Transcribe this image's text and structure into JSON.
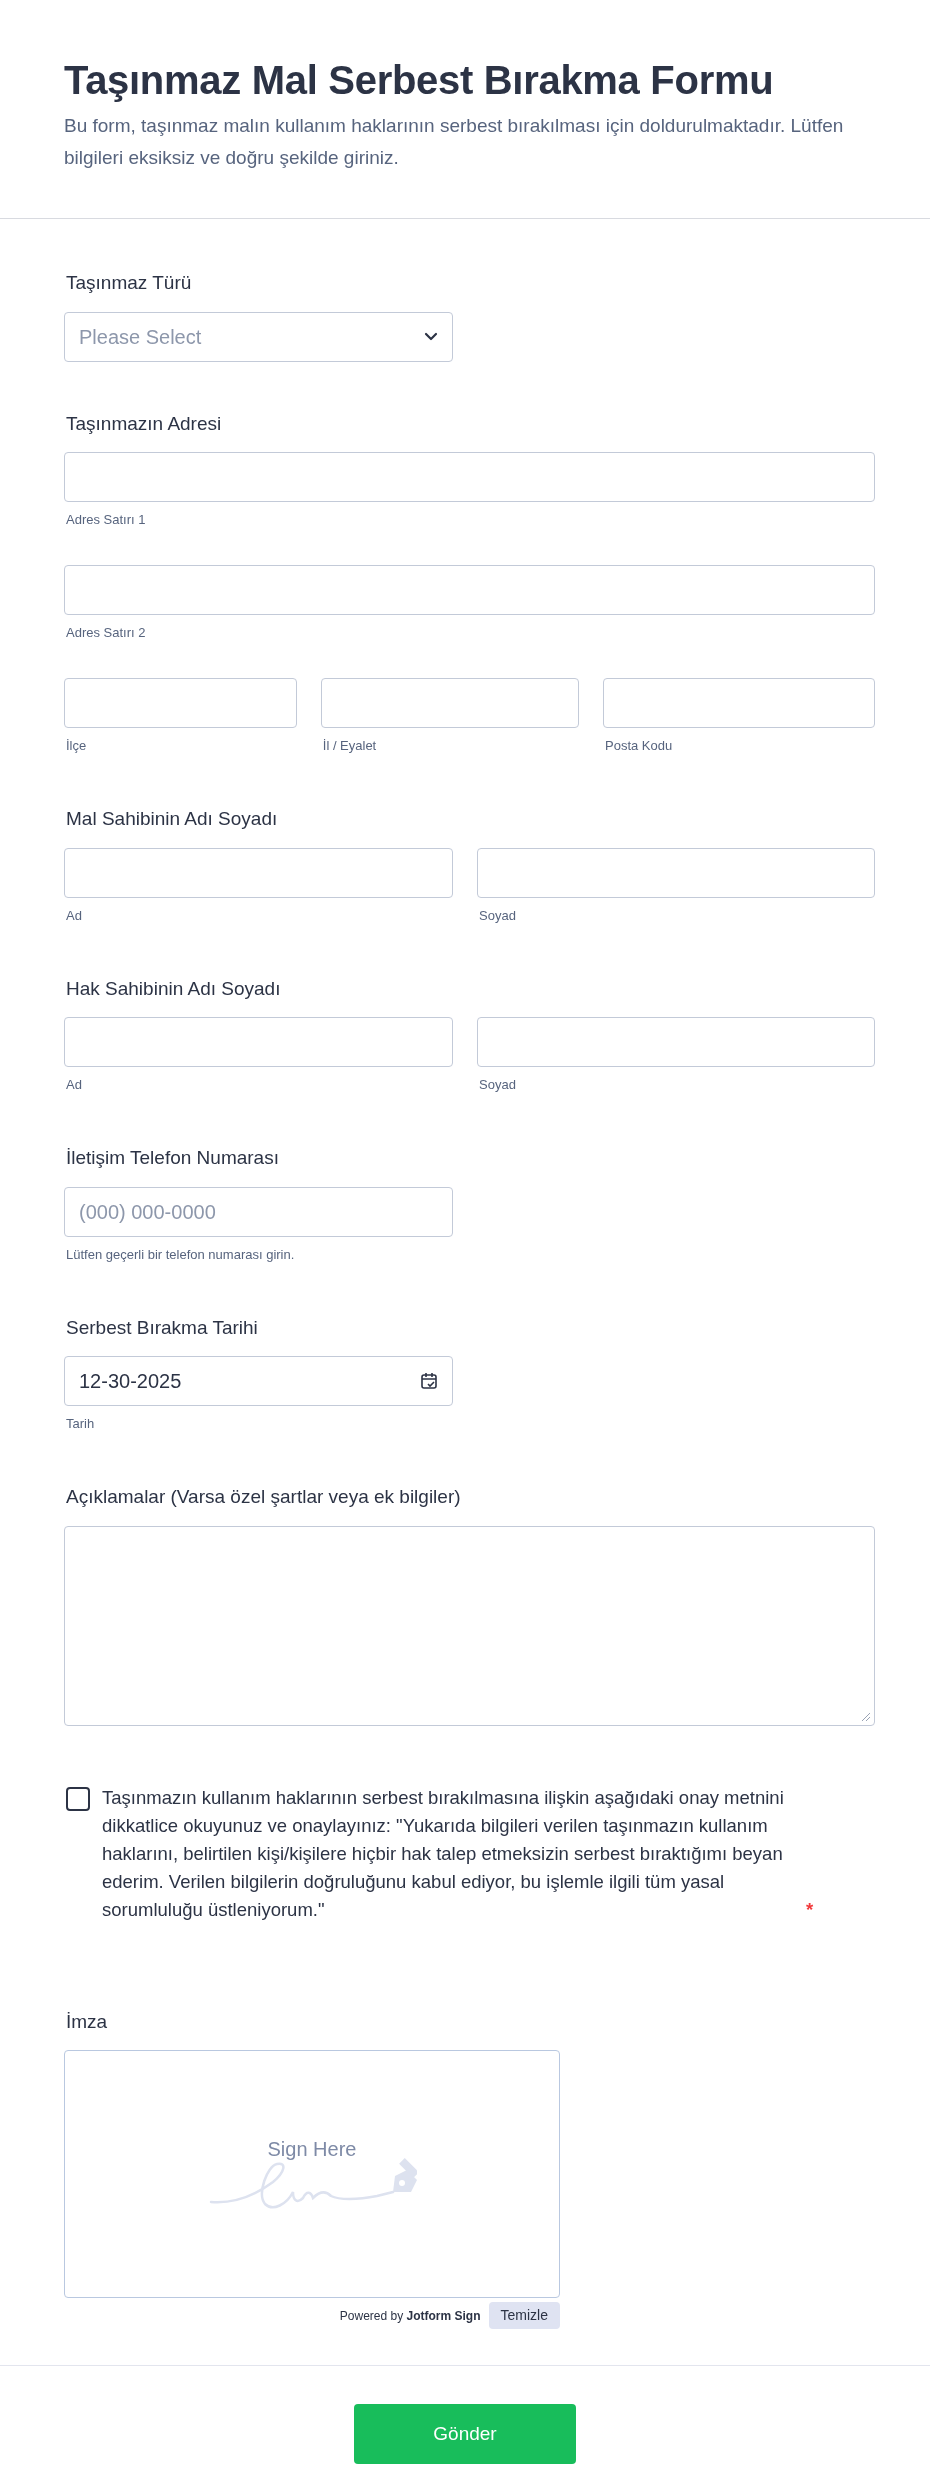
{
  "header": {
    "title": "Taşınmaz Mal Serbest Bırakma Formu",
    "description": "Bu form, taşınmaz malın kullanım haklarının serbest bırakılması için doldurulmaktadır. Lütfen bilgileri eksiksiz ve doğru şekilde giriniz."
  },
  "fields": [
    {
      "kind": "select",
      "label": "Taşınmaz Türü",
      "placeholder": "Please Select"
    },
    {
      "kind": "address",
      "label": "Taşınmazın Adresi",
      "rows": [
        [
          {
            "sublabel": "Adres Satırı 1"
          }
        ],
        [
          {
            "sublabel": "Adres Satırı 2"
          }
        ],
        [
          {
            "sublabel": "İlçe"
          },
          {
            "sublabel": "İl / Eyalet"
          },
          {
            "sublabel": "Posta Kodu"
          }
        ]
      ]
    },
    {
      "kind": "name",
      "label": "Mal Sahibinin Adı Soyadı",
      "rows": [
        [
          {
            "sublabel": "Ad"
          },
          {
            "sublabel": "Soyad"
          }
        ]
      ]
    },
    {
      "kind": "name",
      "label": "Hak Sahibinin Adı Soyadı",
      "rows": [
        [
          {
            "sublabel": "Ad"
          },
          {
            "sublabel": "Soyad"
          }
        ]
      ]
    },
    {
      "kind": "phone",
      "label": "İletişim Telefon Numarası",
      "placeholder": "(000) 000-0000",
      "sublabel": "Lütfen geçerli bir telefon numarası girin."
    },
    {
      "kind": "date",
      "label": "Serbest Bırakma Tarihi",
      "value": "12-30-2025",
      "sublabel": "Tarih"
    },
    {
      "kind": "textarea",
      "label": "Açıklamalar (Varsa özel şartlar veya ek bilgiler)"
    },
    {
      "kind": "consent",
      "checked": false,
      "text": "Taşınmazın kullanım haklarının serbest bırakılmasına ilişkin aşağıdaki onay metnini dikkatlice okuyunuz ve onaylayınız: \"Yukarıda bilgileri verilen taşınmazın kullanım haklarını, belirtilen kişi/kişilere hiçbir hak talep etmeksizin serbest bıraktığımı beyan ederim. Verilen bilgilerin doğruluğunu kabul ediyor, bu işlemle ilgili tüm yasal sorumluluğu üstleniyorum.\"",
      "required_mark": "*"
    },
    {
      "kind": "signature",
      "label": "İmza",
      "prompt": "Sign Here",
      "powered_by": "Powered by **Jotform Sign**",
      "clear_button": "Temizle"
    }
  ],
  "submit": "Gönder"
}
